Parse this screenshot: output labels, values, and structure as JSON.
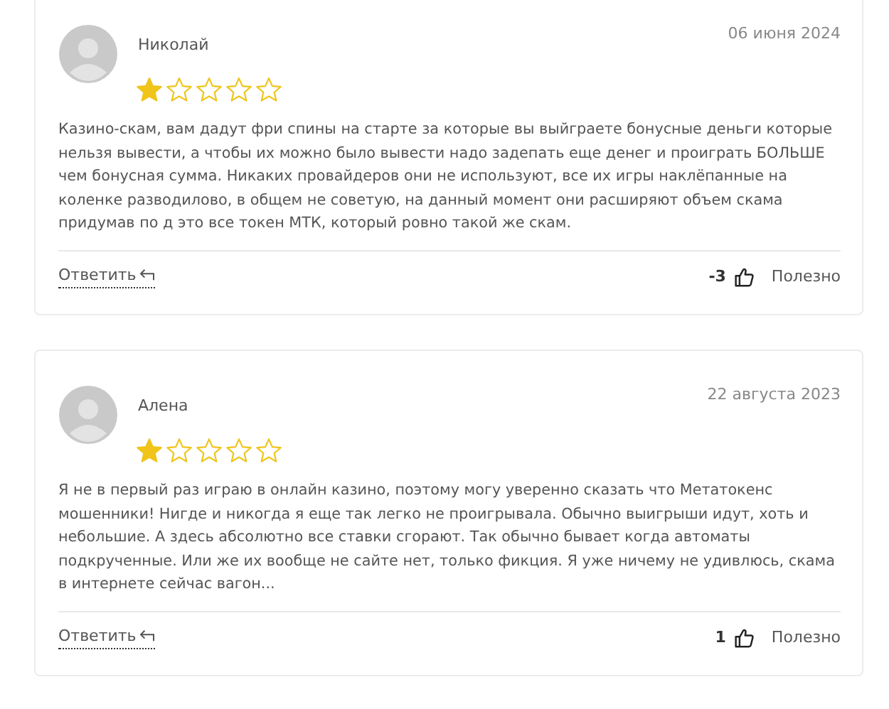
{
  "reviews": [
    {
      "author": "Николай",
      "date": "06 июня 2024",
      "stars": 1,
      "text": "Казино-скам, вам дадут фри спины на старте за которые вы выйграете бонусные деньги которые нельзя вывести, а чтобы их можно было вывести надо задепать еще денег и проиграть БОЛЬШЕ чем бонусная сумма. Никаких провайдеров они не используют, все их игры наклёпанные на коленке разводилово, в общем не советую, на данный момент они расширяют объем скама придумав по д это все токен МТК, который ровно такой же скам.",
      "reply": "Ответить",
      "votes": "-3",
      "helpful": "Полезно"
    },
    {
      "author": "Алена",
      "date": "22 августа 2023",
      "stars": 1,
      "text": "Я не в первый раз играю в онлайн казино, поэтому могу уверенно сказать что Метатокенс мошенники! Нигде и никогда я еще так легко не проигрывала. Обычно выигрыши идут, хоть и небольшие. А здесь абсолютно все ставки сгорают. Так обычно бывает когда автоматы подкрученные. Или же их вообще не сайте нет, только фикция. Я уже ничему не удивлюсь, скама в интернете сейчас вагон...",
      "reply": "Ответить",
      "votes": "1",
      "helpful": "Полезно"
    }
  ]
}
